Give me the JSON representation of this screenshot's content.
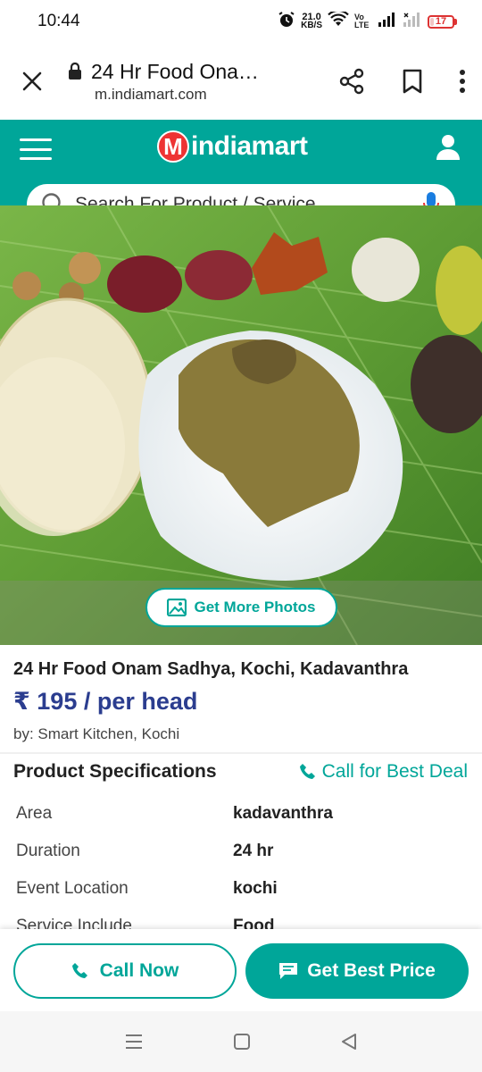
{
  "status": {
    "time": "10:44",
    "speed_value": "21.0",
    "speed_unit": "KB/S",
    "volte": "Vo LTE",
    "battery": "17"
  },
  "browser": {
    "title": "24 Hr Food Ona…",
    "url": "m.indiamart.com"
  },
  "header": {
    "logo_text": "indiamart",
    "logo_badge": "M",
    "search_placeholder": "Search For Product / Service"
  },
  "hero": {
    "more_photos_label": "Get More Photos"
  },
  "product": {
    "title": "24 Hr Food Onam Sadhya, Kochi, Kadavanthra",
    "price": "₹ 195 / per head",
    "seller": "by: Smart Kitchen, Kochi"
  },
  "specs": {
    "heading": "Product Specifications",
    "call_label": "Call for Best Deal",
    "rows": [
      {
        "key": "Area",
        "value": "kadavanthra"
      },
      {
        "key": "Duration",
        "value": "24 hr"
      },
      {
        "key": "Event Location",
        "value": "kochi"
      },
      {
        "key": "Service Include",
        "value": "Food"
      }
    ]
  },
  "actions": {
    "call_now": "Call Now",
    "best_price": "Get Best Price"
  },
  "colors": {
    "brand_teal": "#00a699",
    "price_blue": "#2b3d8f",
    "logo_red": "#e33333"
  }
}
